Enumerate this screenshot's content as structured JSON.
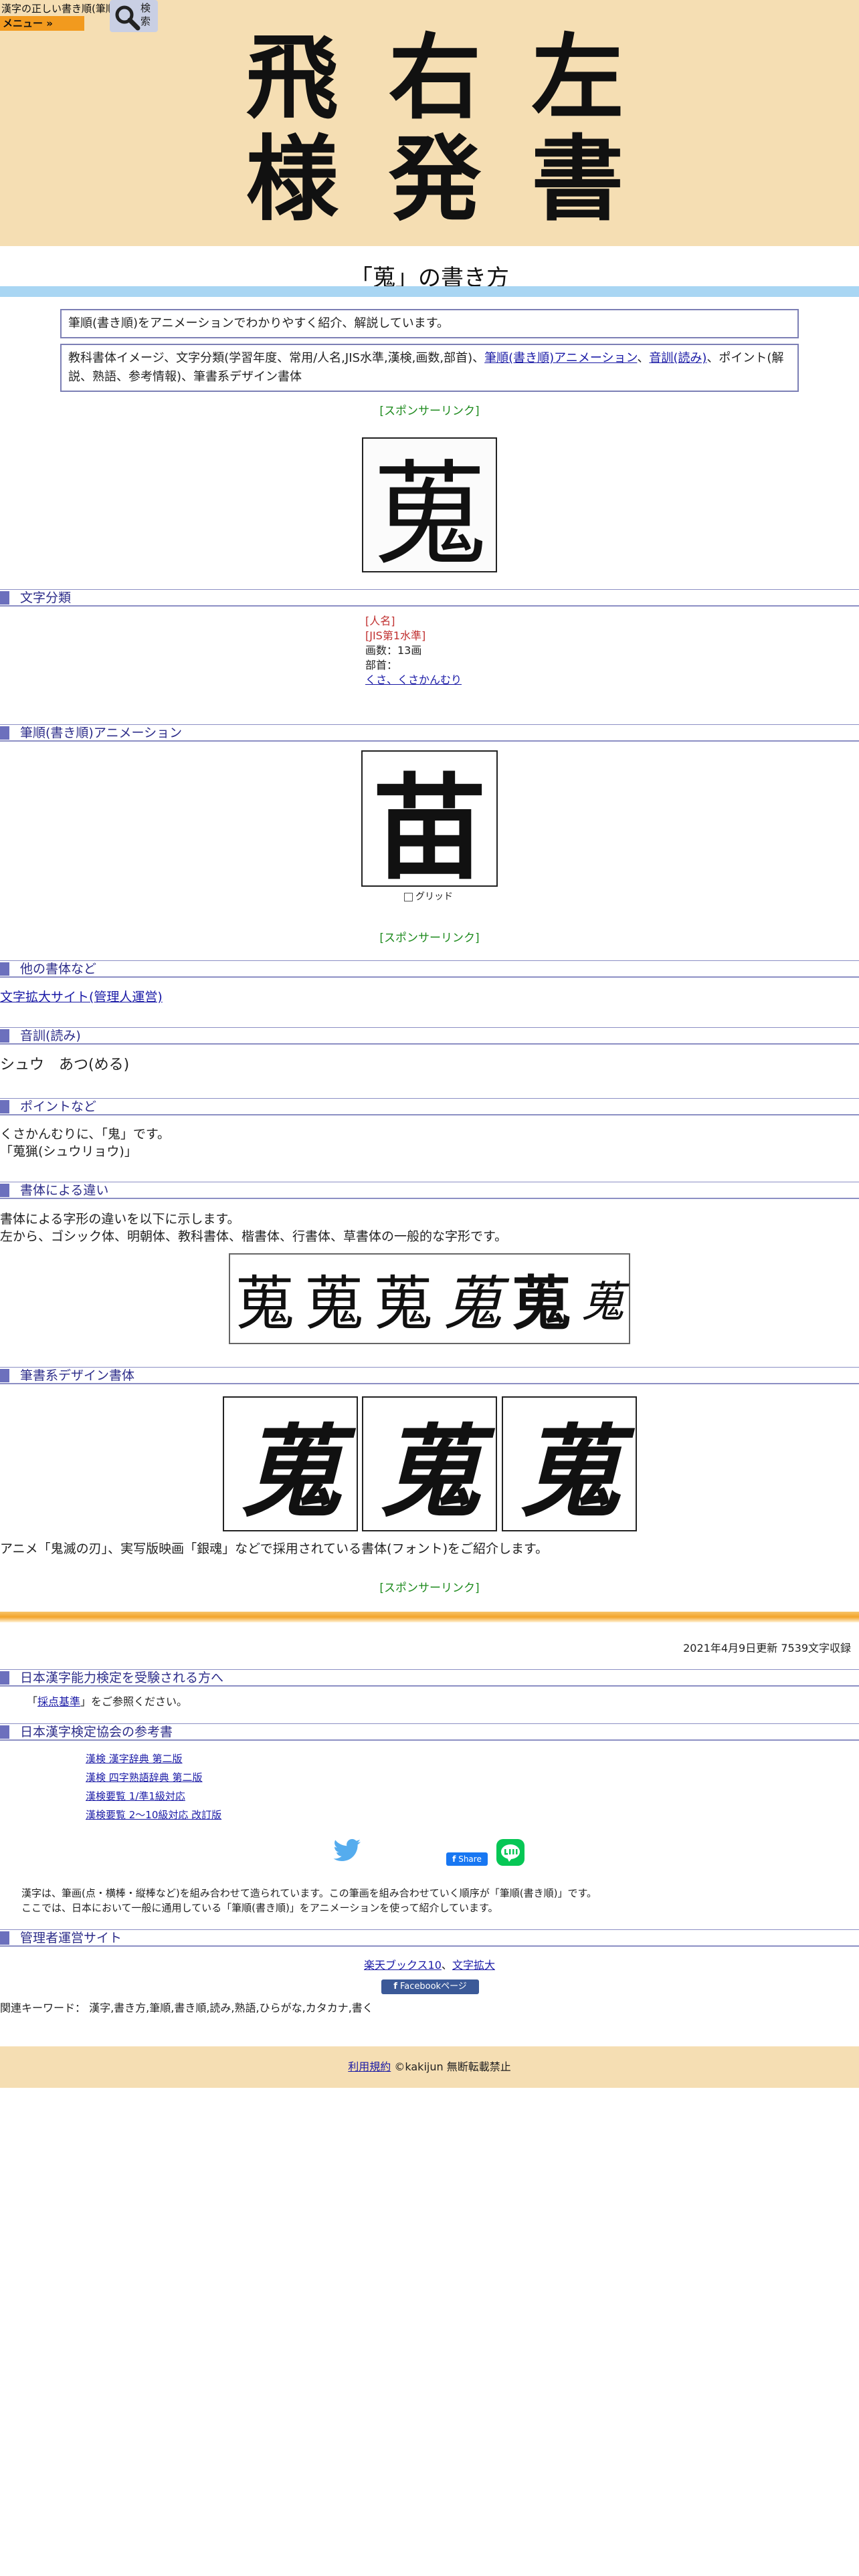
{
  "header": {
    "site_name": "漢字の正しい書き順(筆順)",
    "menu_label": "メニュー »",
    "search_label": "検索",
    "logo_chars": [
      "飛",
      "右",
      "左",
      "様",
      "発",
      "書"
    ]
  },
  "page": {
    "title": "「蒐」の書き方",
    "intro": "筆順(書き順)をアニメーションでわかりやすく紹介、解説しています。",
    "contents_before": "教科書体イメージ、文字分類(学習年度、常用/人名,JIS水準,漢検,画数,部首)、",
    "contents_link_1": "筆順(書き順)アニメーション",
    "contents_sep": "、",
    "contents_link_2": "音訓(読み)",
    "contents_after": "、ポイント(解説、熟語、参考情報)、筆書系デザイン書体",
    "sponsor_link": "[スポンサーリンク]",
    "kanji": "蒐",
    "kanji_partial": "苗"
  },
  "classification": {
    "heading": "文字分類",
    "tag_1": "[人名]",
    "tag_2": "[JIS第1水準]",
    "strokes": "画数：13画",
    "radical_label": "部首：",
    "radical_link": "くさ、くさかんむり"
  },
  "animation": {
    "heading": "筆順(書き順)アニメーション",
    "grid_label": "グリッド"
  },
  "other_fonts": {
    "heading": "他の書体など",
    "link": "文字拡大サイト(管理人運営)"
  },
  "reading": {
    "heading": "音訓(読み)",
    "text": "シュウ　あつ(める)"
  },
  "point": {
    "heading": "ポイントなど",
    "line_1": "くさかんむりに、「鬼」です。",
    "line_2": "「蒐猟(シュウリョウ)」"
  },
  "font_diff": {
    "heading": "書体による違い",
    "line_1": "書体による字形の違いを以下に示します。",
    "line_2": "左から、ゴシック体、明朝体、教科書体、楷書体、行書体、草書体の一般的な字形です。"
  },
  "design": {
    "heading": "筆書系デザイン書体",
    "caption": "アニメ「鬼滅の刃」、実写版映画「銀魂」などで採用されている書体(フォント)をご紹介します。"
  },
  "stats": {
    "updated": "2021年4月9日更新 7539文字収録"
  },
  "kentei": {
    "heading": "日本漢字能力検定を受験される方へ",
    "text_before": "「",
    "link": "採点基準",
    "text_after": "」をご参照ください。"
  },
  "books": {
    "heading": "日本漢字検定協会の参考書",
    "items": [
      "漢検 漢字辞典 第二版",
      "漢検 四字熟語辞典 第二版",
      "漢検要覧 1/準1級対応",
      "漢検要覧 2～10級対応 改訂版"
    ]
  },
  "social": {
    "fb_share": "Share"
  },
  "about": {
    "line_1": "漢字は、筆画(点・横棒・縦棒など)を組み合わせて造られています。この筆画を組み合わせていく順序が「筆順(書き順)」です。",
    "line_2": "ここでは、日本において一般に通用している「筆順(書き順)」をアニメーションを使って紹介しています。"
  },
  "admin": {
    "heading": "管理者運営サイト",
    "link_1": "楽天ブックス10",
    "sep": "、",
    "link_2": "文字拡大",
    "fb_page": "Facebookページ"
  },
  "keywords": "関連キーワード： 漢字,書き方,筆順,書き順,読み,熟語,ひらがな,カタカナ,書く",
  "footer": {
    "terms": "利用規約",
    "copyright": "©kakijun 無断転載禁止"
  },
  "colors": {
    "banner": "#f5deb3",
    "accent": "#f29a1e",
    "heading_bar": "#6c70bd",
    "sponsor": "#1d8a1d"
  }
}
